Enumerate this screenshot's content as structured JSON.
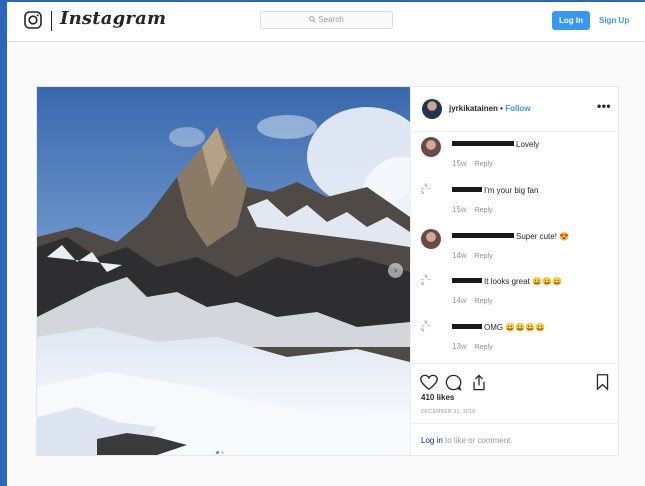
{
  "header": {
    "brand": "Instagram",
    "search_placeholder": "Search",
    "login_label": "Log In",
    "signup_label": "Sign Up"
  },
  "post": {
    "username": "jyrkikatainen",
    "separator": "•",
    "follow_label": "Follow",
    "more_label": "•••",
    "likes": "410 likes",
    "date": "DECEMBER 31, 2018",
    "login_link": "Log in",
    "login_rest": " to like or comment.",
    "carousel_dots": 2,
    "active_dot": 0
  },
  "comments": [
    {
      "avatar": "photo",
      "username_redacted": true,
      "text": "Lovely",
      "time": "15w",
      "reply": "Reply"
    },
    {
      "avatar": "broken",
      "avatar_alt": "_v_\ns",
      "username_redacted": true,
      "text": "I'm your big fan",
      "time": "15w",
      "reply": "Reply"
    },
    {
      "avatar": "photo",
      "username_redacted": true,
      "text": "Super cute! 😍",
      "time": "14w",
      "reply": "Reply"
    },
    {
      "avatar": "broken",
      "avatar_alt": "_v_\ns",
      "username_redacted": true,
      "text": "It looks great 😀😀😀",
      "time": "14w",
      "reply": "Reply"
    },
    {
      "avatar": "broken",
      "avatar_alt": "_v_\ns",
      "username_redacted": true,
      "text": "OMG 😀😀😀😀",
      "time": "13w",
      "reply": "Reply"
    }
  ],
  "colors": {
    "accent": "#3897f0",
    "frame": "#2b66b8",
    "text": "#262626",
    "muted": "#999999"
  }
}
